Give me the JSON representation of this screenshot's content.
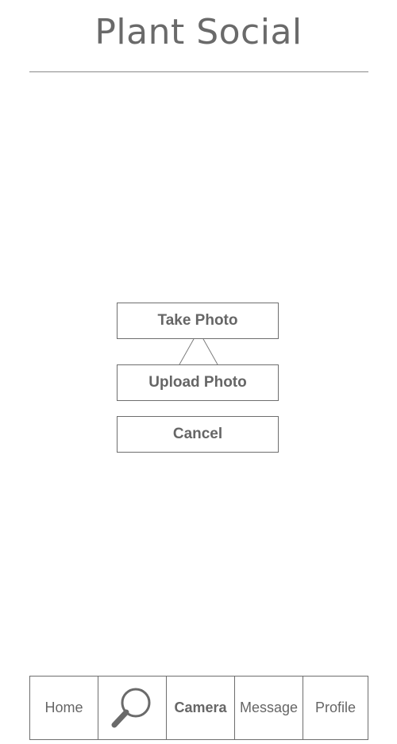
{
  "header": {
    "title": "Plant Social"
  },
  "photo_menu": {
    "take_photo_label": "Take Photo",
    "upload_photo_label": "Upload Photo",
    "cancel_label": "Cancel"
  },
  "bottom_nav": {
    "items": [
      {
        "label": "Home",
        "icon": null,
        "active": false
      },
      {
        "label": "",
        "icon": "search-icon",
        "active": false
      },
      {
        "label": "Camera",
        "icon": null,
        "active": true
      },
      {
        "label": "Message",
        "icon": null,
        "active": false
      },
      {
        "label": "Profile",
        "icon": null,
        "active": false
      }
    ]
  },
  "colors": {
    "text": "#666666",
    "border": "#6e6e6e",
    "background": "#ffffff"
  }
}
